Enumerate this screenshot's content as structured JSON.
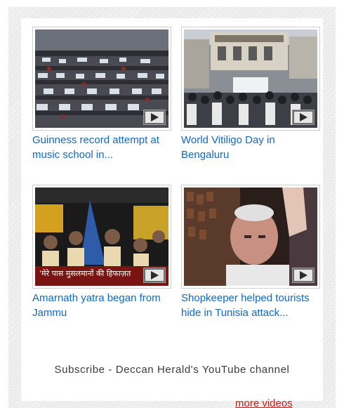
{
  "videos": [
    {
      "title": "Guinness record attempt at music school in...",
      "icon": "play-icon"
    },
    {
      "title": "World Vitiligo Day in Bengaluru",
      "icon": "play-icon"
    },
    {
      "title": "Amarnath yatra began from Jammu",
      "icon": "play-icon"
    },
    {
      "title": "Shopkeeper helped tourists hide in Tunisia attack...",
      "icon": "play-icon"
    }
  ],
  "thumb3_caption": "'मेरे पास मुसलमानों की हिफाज़त",
  "subscribe_text": "Subscribe - Deccan Herald's YouTube channel",
  "more_link": "more videos",
  "colors": {
    "link": "#1168c1",
    "more": "#c0211e",
    "text": "#3a3a3a"
  }
}
